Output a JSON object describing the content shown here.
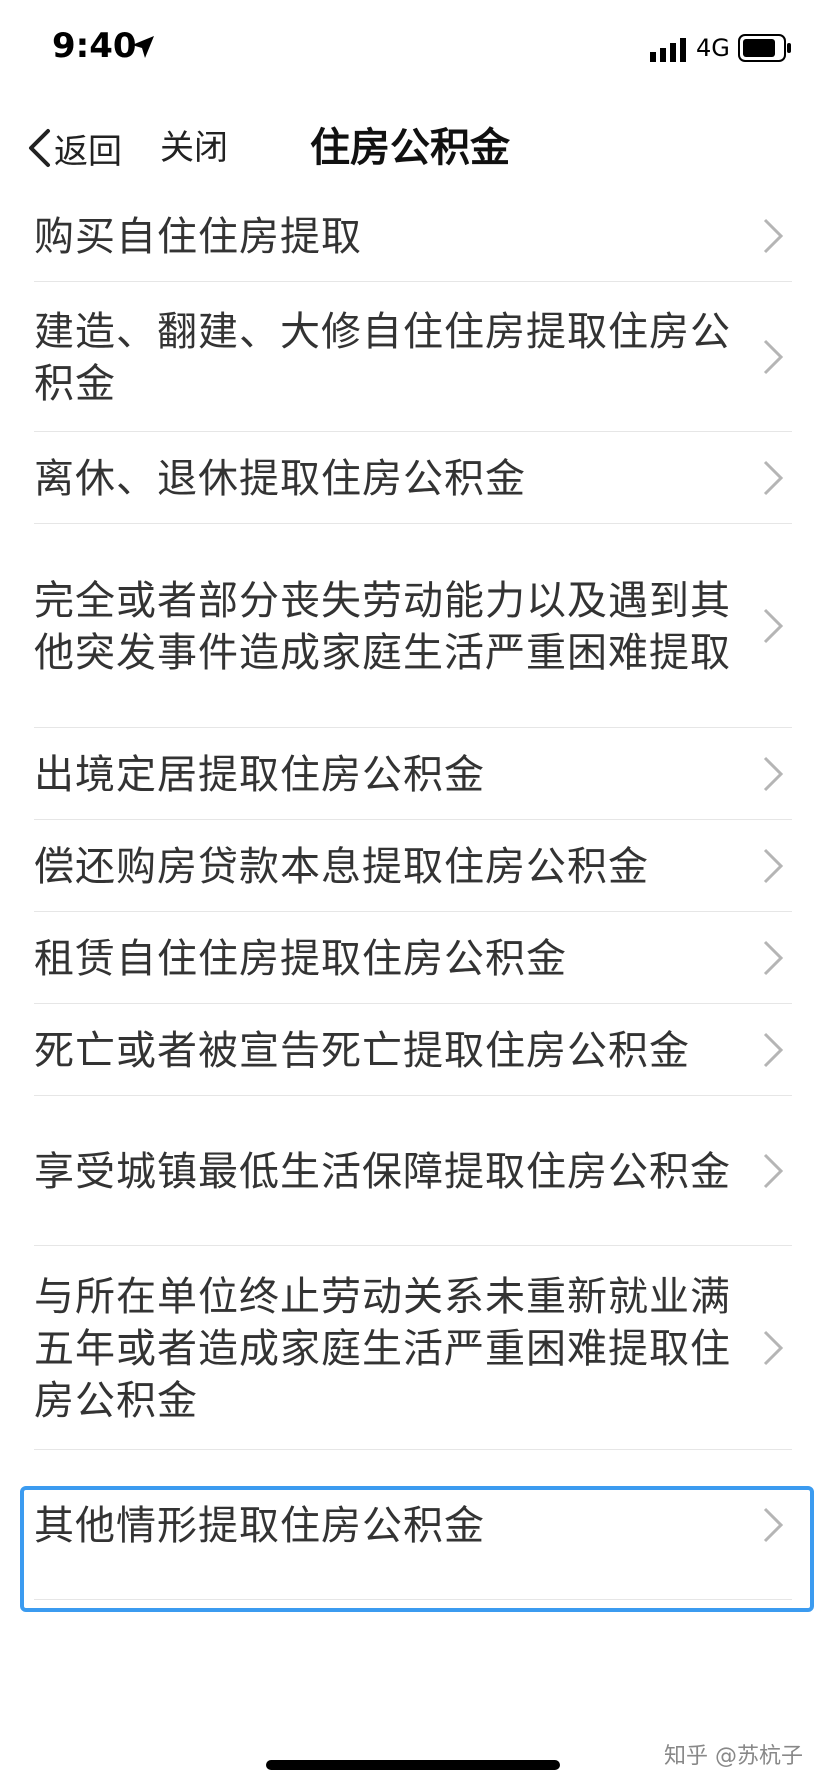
{
  "status_bar": {
    "time": "9:40",
    "network": "4G",
    "icons": [
      "location-arrow-icon",
      "signal-icon",
      "battery-icon"
    ]
  },
  "nav": {
    "back_label": "返回",
    "close_label": "关闭",
    "title": "住房公积金"
  },
  "list": {
    "items": [
      {
        "label": "购买自住住房提取"
      },
      {
        "label": "建造、翻建、大修自住住房提取住房公积金"
      },
      {
        "label": "离休、退休提取住房公积金"
      },
      {
        "label": "完全或者部分丧失劳动能力以及遇到其他突发事件造成家庭生活严重困难提取"
      },
      {
        "label": "出境定居提取住房公积金"
      },
      {
        "label": "偿还购房贷款本息提取住房公积金"
      },
      {
        "label": "租赁自住住房提取住房公积金"
      },
      {
        "label": "死亡或者被宣告死亡提取住房公积金"
      },
      {
        "label": "享受城镇最低生活保障提取住房公积金"
      },
      {
        "label": "与所在单位终止劳动关系未重新就业满五年或者造成家庭生活严重困难提取住房公积金"
      },
      {
        "label": "其他情形提取住房公积金"
      }
    ],
    "highlighted_item": "其他情形提取住房公积金"
  },
  "colors": {
    "highlight": "#3b9bf0",
    "divider": "#e6e6e6",
    "text": "#333333"
  },
  "watermark": "知乎 @苏杭子"
}
